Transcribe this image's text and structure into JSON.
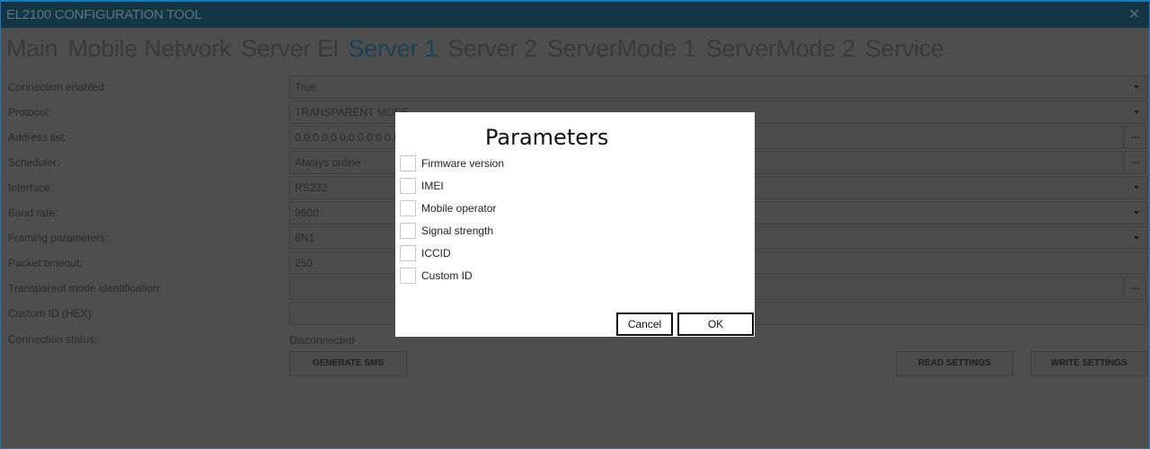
{
  "window": {
    "title": "EL2100 CONFIGURATION TOOL",
    "close_glyph": "✕"
  },
  "tabs": [
    {
      "label": "Main",
      "active": false
    },
    {
      "label": "Mobile Network",
      "active": false
    },
    {
      "label": "Server El",
      "active": false
    },
    {
      "label": "Server 1",
      "active": true
    },
    {
      "label": "Server 2",
      "active": false
    },
    {
      "label": "ServerMode 1",
      "active": false
    },
    {
      "label": "ServerMode 2",
      "active": false
    },
    {
      "label": "Service",
      "active": false
    }
  ],
  "form": {
    "rows": [
      {
        "label": "Connection enabled:",
        "value": "True",
        "control": "dropdown"
      },
      {
        "label": "Protocol:",
        "value": "TRANSPARENT MODE",
        "control": "dropdown"
      },
      {
        "label": "Address list:",
        "value": "0.0.0.0:0  0.0.0.0:0  0.0.0.0:0",
        "control": "ellipsis"
      },
      {
        "label": "Scheduler:",
        "value": "Always online",
        "control": "ellipsis"
      },
      {
        "label": "Interface:",
        "value": "RS232",
        "control": "dropdown"
      },
      {
        "label": "Baud rate:",
        "value": "9600",
        "control": "dropdown"
      },
      {
        "label": "Framing parameters:",
        "value": "8N1",
        "control": "dropdown"
      },
      {
        "label": "Packet timeout:",
        "value": "250",
        "control": "text"
      },
      {
        "label": "Transparent mode identification:",
        "value": "",
        "control": "ellipsis"
      },
      {
        "label": "Custom ID (HEX):",
        "value": "",
        "control": "text"
      }
    ],
    "connection_status_label": "Connection status:",
    "connection_status_value": "Disconnected",
    "ellipsis_label": "...",
    "generate_sms_label": "GENERATE SMS",
    "read_settings_label": "READ SETTINGS",
    "write_settings_label": "WRITE SETTINGS"
  },
  "dialog": {
    "title": "Parameters",
    "options": [
      {
        "label": "Firmware version",
        "checked": false
      },
      {
        "label": "IMEI",
        "checked": false
      },
      {
        "label": "Mobile operator",
        "checked": false
      },
      {
        "label": "Signal strength",
        "checked": false
      },
      {
        "label": "ICCID",
        "checked": false
      },
      {
        "label": "Custom ID",
        "checked": false
      }
    ],
    "cancel_label": "Cancel",
    "ok_label": "OK"
  }
}
